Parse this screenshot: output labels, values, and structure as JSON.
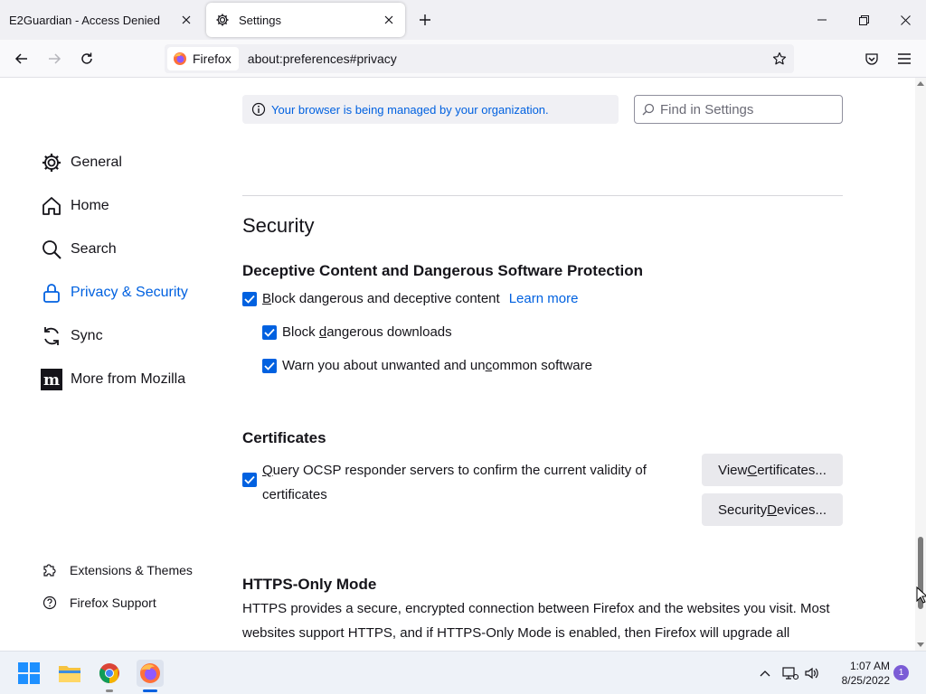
{
  "tabs": [
    {
      "title": "E2Guardian - Access Denied",
      "active": false
    },
    {
      "title": "Settings",
      "active": true
    }
  ],
  "navbar": {
    "identity_label": "Firefox",
    "url": "about:preferences#privacy"
  },
  "sidebar": {
    "items": [
      {
        "label": "General",
        "icon": "gear-icon"
      },
      {
        "label": "Home",
        "icon": "home-icon"
      },
      {
        "label": "Search",
        "icon": "search-icon"
      },
      {
        "label": "Privacy & Security",
        "icon": "lock-icon",
        "selected": true
      },
      {
        "label": "Sync",
        "icon": "sync-icon"
      },
      {
        "label": "More from Mozilla",
        "icon": "mozilla-icon"
      }
    ],
    "footer": [
      {
        "label": "Extensions & Themes",
        "icon": "puzzle-icon"
      },
      {
        "label": "Firefox Support",
        "icon": "help-icon"
      }
    ]
  },
  "policy_notice": "Your browser is being managed by your organization.",
  "find": {
    "placeholder": "Find in Settings"
  },
  "security": {
    "heading": "Security",
    "deceptive": {
      "heading": "Deceptive Content and Dangerous Software Protection",
      "block_pre": "",
      "block_ul": "B",
      "block_post": "lock dangerous and deceptive content",
      "learn_more": "Learn more",
      "downloads_pre": "Block ",
      "downloads_ul": "d",
      "downloads_post": "angerous downloads",
      "unwanted_pre": "Warn you about unwanted and un",
      "unwanted_ul": "c",
      "unwanted_post": "ommon software"
    },
    "certificates": {
      "heading": "Certificates",
      "ocsp_pre": "",
      "ocsp_ul": "Q",
      "ocsp_line1": "uery OCSP responder servers to confirm the current validity of",
      "ocsp_line2": "certificates",
      "view_pre": "View ",
      "view_ul": "C",
      "view_post": "ertificates...",
      "devices_pre": "Security ",
      "devices_ul": "D",
      "devices_post": "evices..."
    },
    "https": {
      "heading": "HTTPS-Only Mode",
      "line1": "HTTPS provides a secure, encrypted connection between Firefox and the websites you visit. Most",
      "line2": "websites support HTTPS, and if HTTPS-Only Mode is enabled, then Firefox will upgrade all"
    }
  },
  "taskbar": {
    "time": "1:07 AM",
    "date": "8/25/2022",
    "notification_count": "1"
  },
  "colors": {
    "accent": "#0061e0",
    "notif": "#7b5cd6"
  }
}
